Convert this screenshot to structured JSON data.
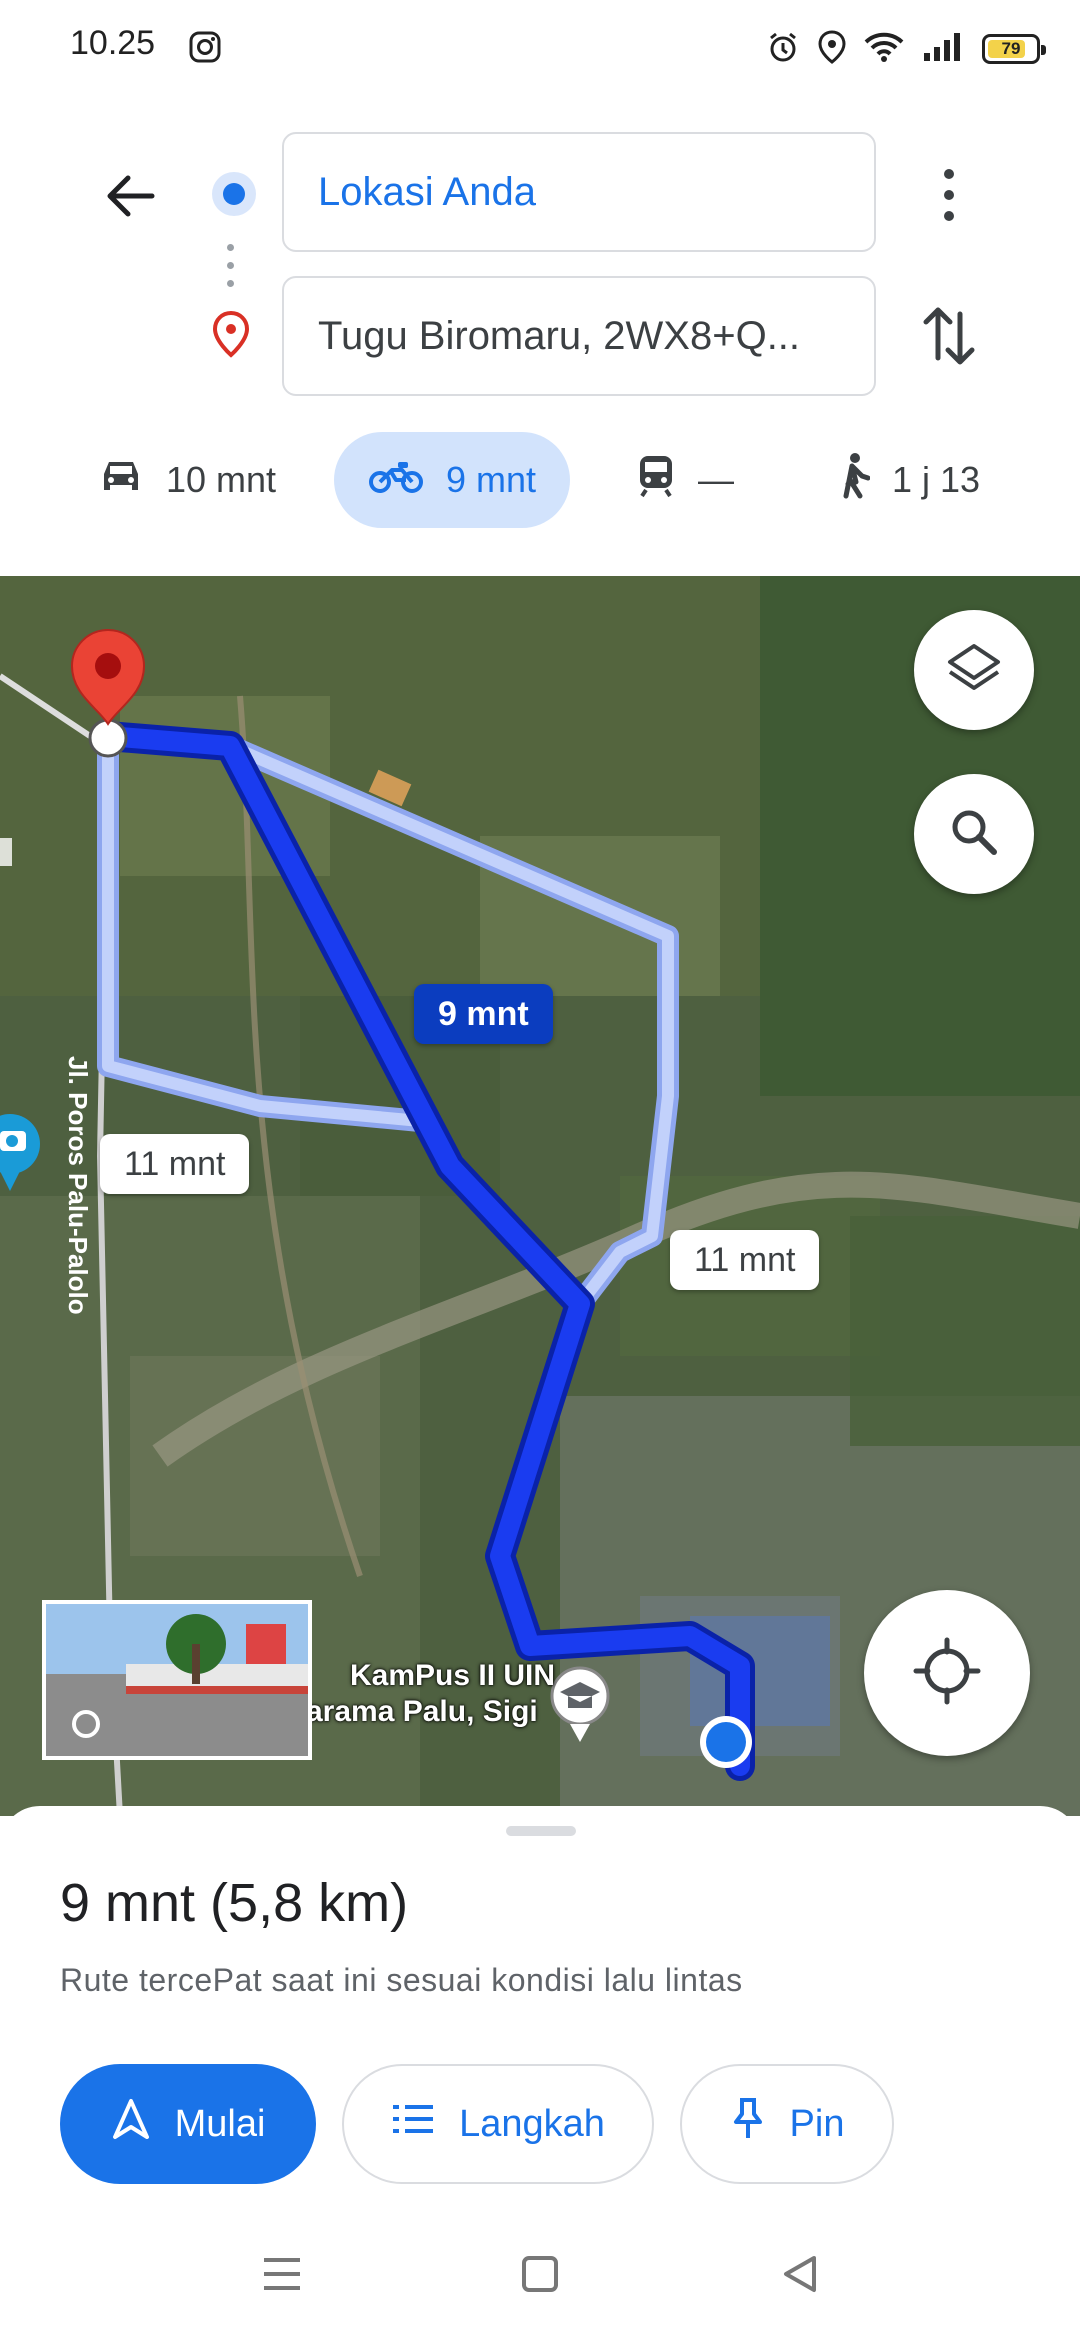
{
  "status_bar": {
    "time": "10.25",
    "battery_level": "79",
    "icons": [
      "instagram-icon",
      "alarm-icon",
      "location-icon",
      "wifi-icon",
      "signal-icon",
      "battery-icon"
    ]
  },
  "directions": {
    "origin": "Lokasi Anda",
    "destination": "Tugu Biromaru, 2WX8+Q..."
  },
  "modes": {
    "car": "10 mnt",
    "motorcycle": "9 mnt",
    "transit": "—",
    "walk": "1 j 13"
  },
  "map": {
    "route_labels": {
      "best": "9 mnt",
      "alt_left": "11 mnt",
      "alt_right": "11 mnt"
    },
    "road_label": "Jl. Poros Palu-Palolo",
    "poi": {
      "line1": "KamPus II UIN",
      "line2": "arama Palu, Sigi"
    },
    "colors": {
      "best_route": "#1a3cf0",
      "alt_route": "#a9bdf5",
      "destination_pin": "#ea4335",
      "location_dot": "#1a73e8"
    }
  },
  "sheet": {
    "summary": "9 mnt (5,8 km)",
    "description": "Rute tercePat saat ini sesuai kondisi lalu lintas",
    "start_label": "Mulai",
    "steps_label": "Langkah",
    "pin_label": "Pin"
  }
}
